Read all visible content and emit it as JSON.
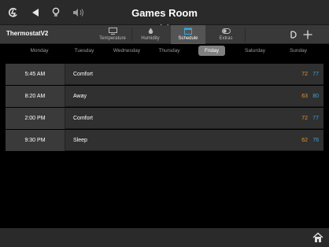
{
  "header": {
    "title": "Games Room",
    "icons": [
      "logo-icon",
      "back-icon",
      "bulb-icon",
      "volume-icon",
      "chevron-down-icon"
    ]
  },
  "tabbar": {
    "device_name": "ThermostatV2",
    "tabs": [
      {
        "label": "Temperature",
        "icon": "monitor-icon",
        "active": false
      },
      {
        "label": "Humidity",
        "icon": "drop-icon",
        "active": false
      },
      {
        "label": "Schedule",
        "icon": "calendar-icon",
        "active": true
      },
      {
        "label": "Extras",
        "icon": "toggle-icon",
        "active": false
      }
    ],
    "right_icons": [
      "power-icon",
      "add-icon"
    ]
  },
  "days": {
    "items": [
      "Monday",
      "Tuesday",
      "Wednesday",
      "Thursday",
      "Friday",
      "Saturday",
      "Sunday"
    ],
    "selected": "Friday"
  },
  "schedule": [
    {
      "time": "5:45 AM",
      "mode": "Comfort",
      "heat": "72",
      "cool": "77"
    },
    {
      "time": "8:20 AM",
      "mode": "Away",
      "heat": "63",
      "cool": "80"
    },
    {
      "time": "2:00 PM",
      "mode": "Comfort",
      "heat": "72",
      "cool": "77"
    },
    {
      "time": "9:30 PM",
      "mode": "Sleep",
      "heat": "62",
      "cool": "76"
    }
  ],
  "colors": {
    "heat": "#e89420",
    "cool": "#39a6dc",
    "accent": "#39a6dc"
  },
  "footer": {
    "icons": [
      "home-icon"
    ]
  }
}
